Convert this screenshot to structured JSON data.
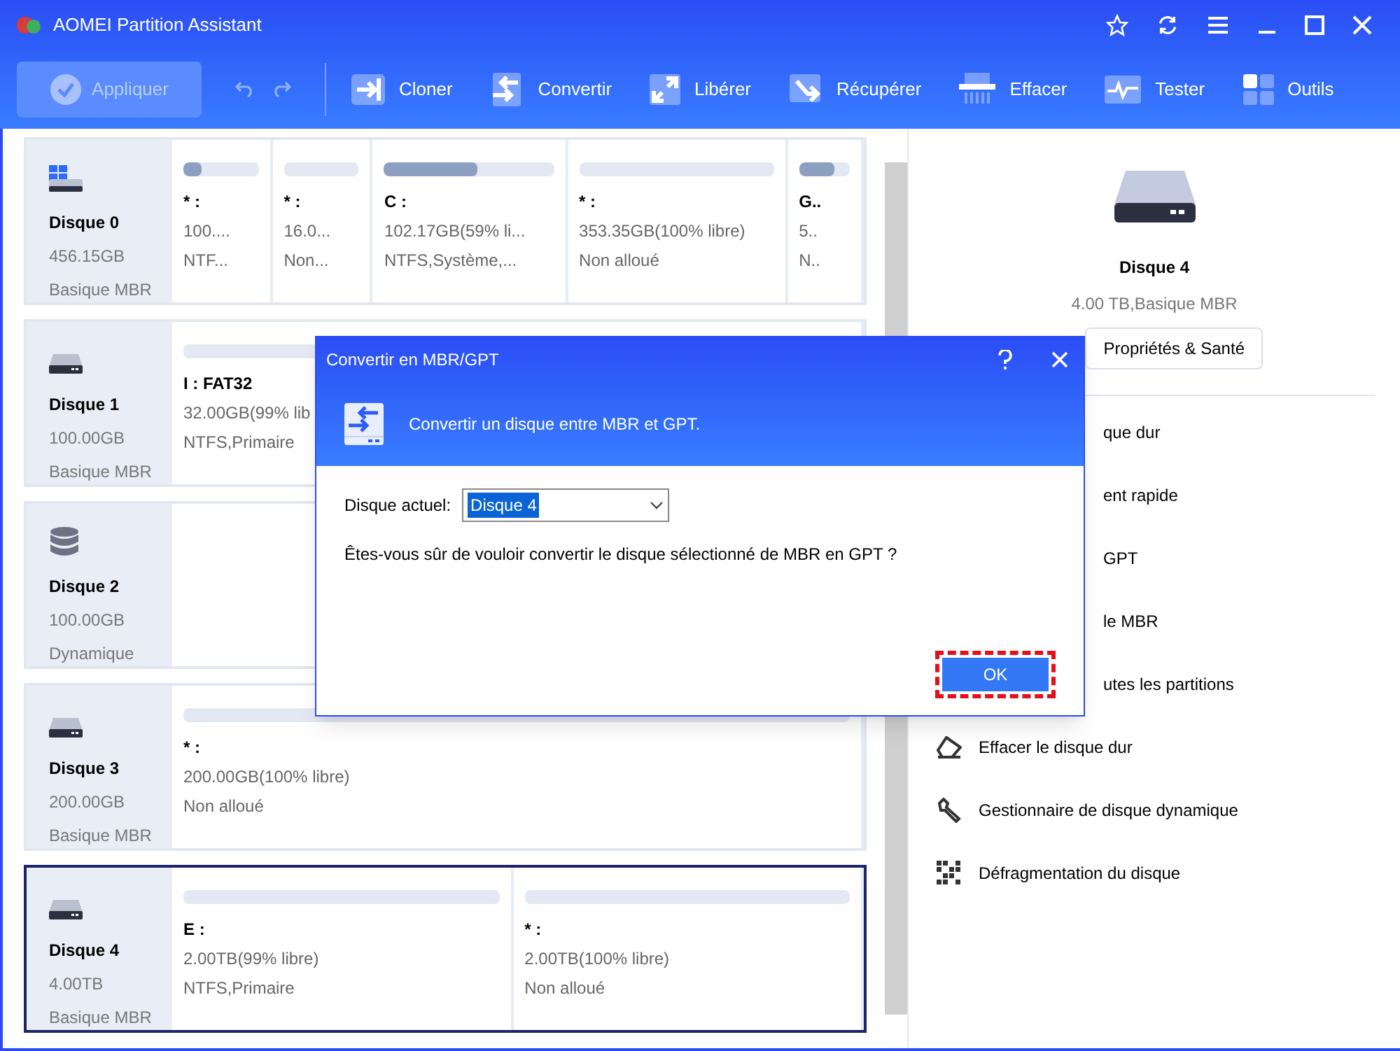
{
  "window": {
    "title": "AOMEI Partition Assistant"
  },
  "toolbar": {
    "apply": {
      "label": "Appliquer",
      "disabled": true
    },
    "tools": [
      {
        "kind": "clone",
        "label": "Cloner"
      },
      {
        "kind": "convert",
        "label": "Convertir"
      },
      {
        "kind": "free",
        "label": "Libérer"
      },
      {
        "kind": "recover",
        "label": "Récupérer"
      },
      {
        "kind": "wipe",
        "label": "Effacer"
      },
      {
        "kind": "test",
        "label": "Tester"
      },
      {
        "kind": "tools",
        "label": "Outils"
      }
    ]
  },
  "disks": [
    {
      "kind": "windows",
      "name": "Disque 0",
      "size": "456.15GB",
      "type": "Basique MBR",
      "selected": false,
      "partitions": [
        {
          "label": "* :",
          "size": "100....",
          "fs": "NTF...",
          "level": 0.25
        },
        {
          "label": "* :",
          "size": "16.0...",
          "fs": "Non..."
        },
        {
          "label": "C :",
          "size": "102.17GB(59% li...",
          "fs": "NTFS,Système,...",
          "level": 0.55
        },
        {
          "label": "* :",
          "size": "353.35GB(100% libre)",
          "fs": "Non alloué"
        },
        {
          "label": "G..",
          "size": "5..",
          "fs": "N..",
          "level": 0.7
        }
      ]
    },
    {
      "kind": "disk",
      "name": "Disque 1",
      "size": "100.00GB",
      "type": "Basique MBR",
      "selected": false,
      "partitions": [
        {
          "label": "I : FAT32",
          "size": "32.00GB(99% lib",
          "fs": "NTFS,Primaire"
        }
      ]
    },
    {
      "kind": "dynamic",
      "name": "Disque 2",
      "size": "100.00GB",
      "type": "Dynamique",
      "selected": false
    },
    {
      "kind": "disk",
      "name": "Disque 3",
      "size": "200.00GB",
      "type": "Basique MBR",
      "selected": false,
      "partitions": [
        {
          "label": "* :",
          "size": "200.00GB(100% libre)",
          "fs": "Non alloué"
        }
      ]
    },
    {
      "kind": "disk",
      "name": "Disque 4",
      "size": "4.00TB",
      "type": "Basique MBR",
      "selected": true,
      "partitions": [
        {
          "label": "E :",
          "size": "2.00TB(99% libre)",
          "fs": "NTFS,Primaire"
        },
        {
          "label": "* :",
          "size": "2.00TB(100% libre)",
          "fs": "Non alloué"
        }
      ]
    }
  ],
  "details": {
    "name": "Disque 4",
    "info": "4.00 TB,Basique MBR",
    "button": "Propriétés & Santé",
    "actions": [
      {
        "kind": "hidden",
        "label": "que dur"
      },
      {
        "kind": "hidden",
        "label": "ent rapide"
      },
      {
        "kind": "hidden",
        "label": "GPT"
      },
      {
        "kind": "hidden",
        "label": "le MBR"
      },
      {
        "kind": "hidden",
        "label": "utes les partitions"
      },
      {
        "kind": "eraser",
        "label": "Effacer le disque dur"
      },
      {
        "kind": "wrench",
        "label": "Gestionnaire de disque dynamique"
      },
      {
        "kind": "defrag",
        "label": "Défragmentation du disque"
      }
    ]
  },
  "dialog": {
    "title": "Convertir en MBR/GPT",
    "subtitle": "Convertir un disque entre MBR et GPT.",
    "field_label": "Disque actuel:",
    "field_value": "Disque 4",
    "question": "Êtes-vous sûr de vouloir convertir le disque sélectionné de MBR en GPT ?",
    "ok": "OK"
  }
}
